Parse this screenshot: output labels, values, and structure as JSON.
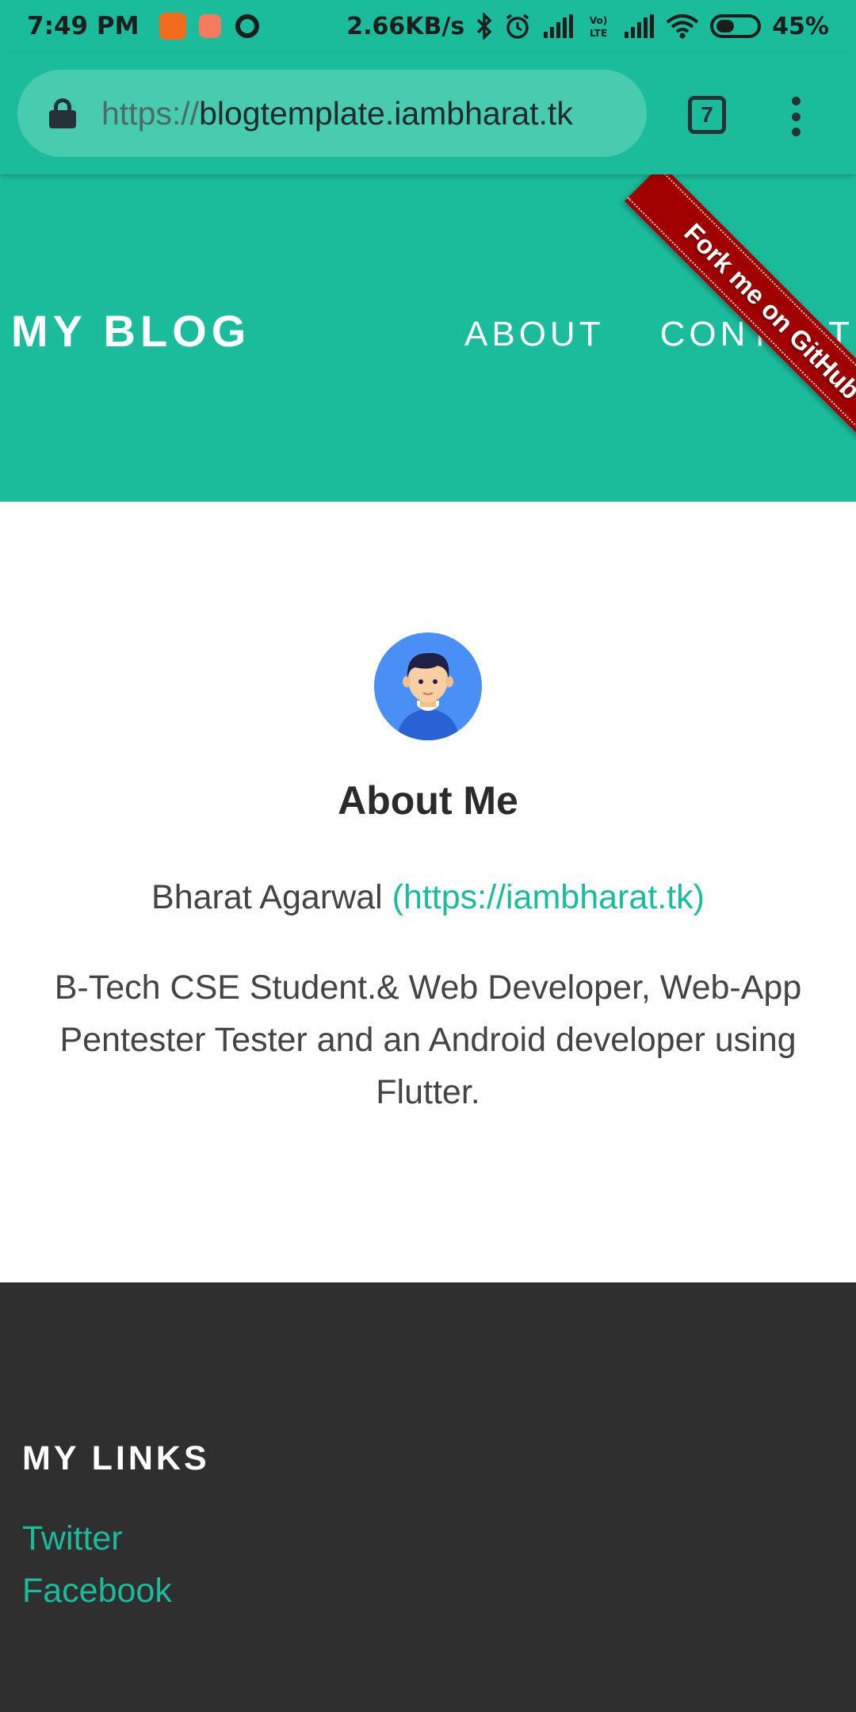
{
  "status_bar": {
    "time": "7:49 PM",
    "net_speed": "2.66KB/s",
    "battery_percent": "45%",
    "battery_level": 0.45,
    "icons": [
      "app-orange-icon",
      "app-red-icon",
      "chrome-icon",
      "bluetooth-icon",
      "alarm-icon",
      "signal-icon",
      "volte-icon",
      "signal-icon",
      "wifi-icon",
      "battery-icon"
    ]
  },
  "browser": {
    "url_scheme": "https://",
    "url_host": "blogtemplate.iambharat.tk",
    "tab_count": "7"
  },
  "site": {
    "brand": "MY BLOG",
    "nav": [
      "ABOUT",
      "CONTACT"
    ],
    "ribbon": "Fork me on GitHub"
  },
  "about": {
    "title": "About Me",
    "name": "Bharat Agarwal",
    "link": "(https://iambharat.tk)",
    "bio": "B-Tech CSE Student.& Web Developer, Web-App Pentester Tester and an Android developer using Flutter."
  },
  "footer": {
    "heading": "MY LINKS",
    "links": [
      "Twitter",
      "Facebook"
    ]
  },
  "colors": {
    "accent": "#1bbc9b",
    "ribbon": "#a00000",
    "footer_bg": "#2f2f2f"
  }
}
